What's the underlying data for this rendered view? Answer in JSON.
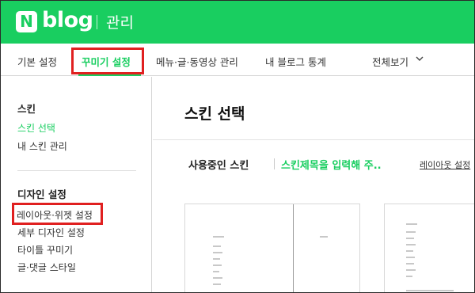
{
  "header": {
    "logo_mark": "N",
    "logo_text": "blog",
    "title": "관리"
  },
  "tabs": {
    "basic": "기본 설정",
    "decorate": "꾸미기 설정",
    "menu": "메뉴·글·동영상 관리",
    "stats": "내 블로그 통계",
    "all": "전체보기"
  },
  "sidebar": {
    "skin_heading": "스킨",
    "skin_select": "스킨 선택",
    "my_skin": "내 스킨 관리",
    "design_heading": "디자인 설정",
    "layout_widget": "레이아웃·위젯 설정",
    "detail_design": "세부 디자인 설정",
    "title_decorate": "타이틀 꾸미기",
    "post_comment_style": "글·댓글 스타일"
  },
  "main": {
    "title": "스킨 선택",
    "in_use_label": "사용중인 스킨",
    "skin_name": "스킨제목을 입력해 주..",
    "layout_link": "레이아웃 설정"
  },
  "colors": {
    "brand_green": "#19ce60",
    "highlight_red": "#e02020"
  },
  "icons": {
    "chevron": "chevron-down-icon"
  }
}
